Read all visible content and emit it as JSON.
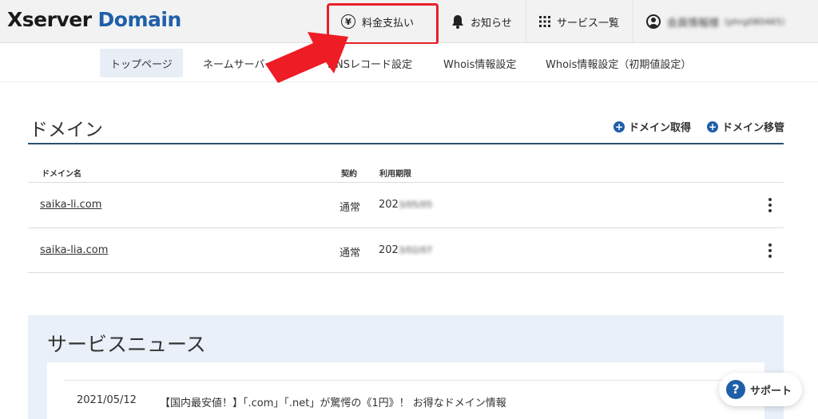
{
  "header": {
    "logo_x": "Xserver",
    "logo_domain": "Domain",
    "nav": {
      "payment": "料金支払い",
      "payment_icon": "yen-icon",
      "news": "お知らせ",
      "news_icon": "bell-icon",
      "services": "サービス一覧",
      "services_icon": "grid-icon",
      "user_name": "会員情報様",
      "user_id": "（phrg080465）",
      "user_icon": "user-icon"
    }
  },
  "subnav": {
    "tabs": [
      "トップページ",
      "ネームサーバー",
      "DNSレコード設定",
      "Whois情報設定",
      "Whois情報設定（初期値設定）"
    ],
    "active_index": 0
  },
  "domain_section": {
    "title": "ドメイン",
    "actions": [
      "ドメイン取得",
      "ドメイン移管"
    ],
    "columns": [
      "ドメイン名",
      "契約",
      "利用期限"
    ],
    "rows": [
      {
        "name": "saika-li.com",
        "contract": "通常",
        "expiry_visible": "202",
        "expiry_blur": "3/05/05"
      },
      {
        "name": "saika-lia.com",
        "contract": "通常",
        "expiry_visible": "202",
        "expiry_blur": "3/02/07"
      }
    ]
  },
  "news_section": {
    "title": "サービスニュース",
    "items": [
      {
        "date": "2021/05/12",
        "text": "【国内最安値！】「.com」「.net」が驚愕の《1円》！ お得なドメイン情報"
      }
    ]
  },
  "support": {
    "label": "サポート",
    "icon": "question-icon"
  },
  "colors": {
    "brand": "#1f5fa8",
    "highlight": "#e8202a",
    "arrow": "#ee1c25",
    "news_bg": "#e9f0f9"
  }
}
